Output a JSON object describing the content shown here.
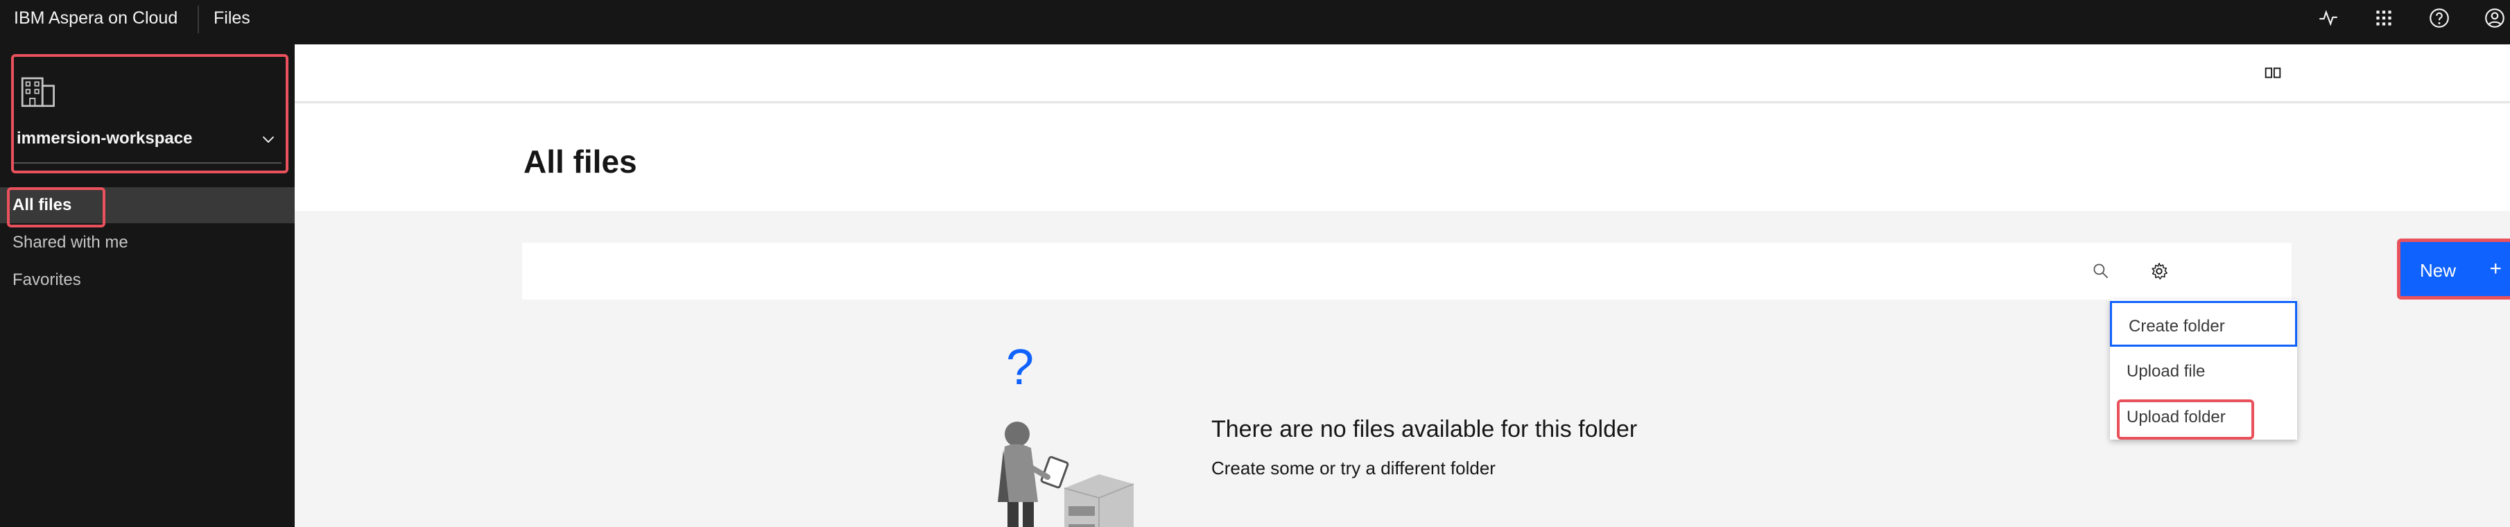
{
  "header": {
    "brand": "IBM Aspera on Cloud",
    "app": "Files",
    "icons": [
      "activity-icon",
      "app-switcher-icon",
      "help-icon",
      "user-profile-icon"
    ]
  },
  "sidebar": {
    "workspace": {
      "name": "immersion-workspace",
      "icon": "building-icon"
    },
    "items": [
      {
        "label": "All files",
        "active": true
      },
      {
        "label": "Shared with me",
        "active": false
      },
      {
        "label": "Favorites",
        "active": false
      }
    ]
  },
  "main": {
    "title": "All files",
    "toolbar": {
      "new_label": "New",
      "new_plus": "+",
      "menu": [
        {
          "label": "Create folder"
        },
        {
          "label": "Upload file"
        },
        {
          "label": "Upload folder"
        }
      ]
    },
    "empty_state": {
      "title": "There are no files available for this folder",
      "subtitle": "Create some or try a different folder"
    }
  },
  "colors": {
    "header_bg": "#161616",
    "primary": "#0f62fe",
    "highlight": "#e9515c",
    "page_bg": "#f4f4f4"
  }
}
